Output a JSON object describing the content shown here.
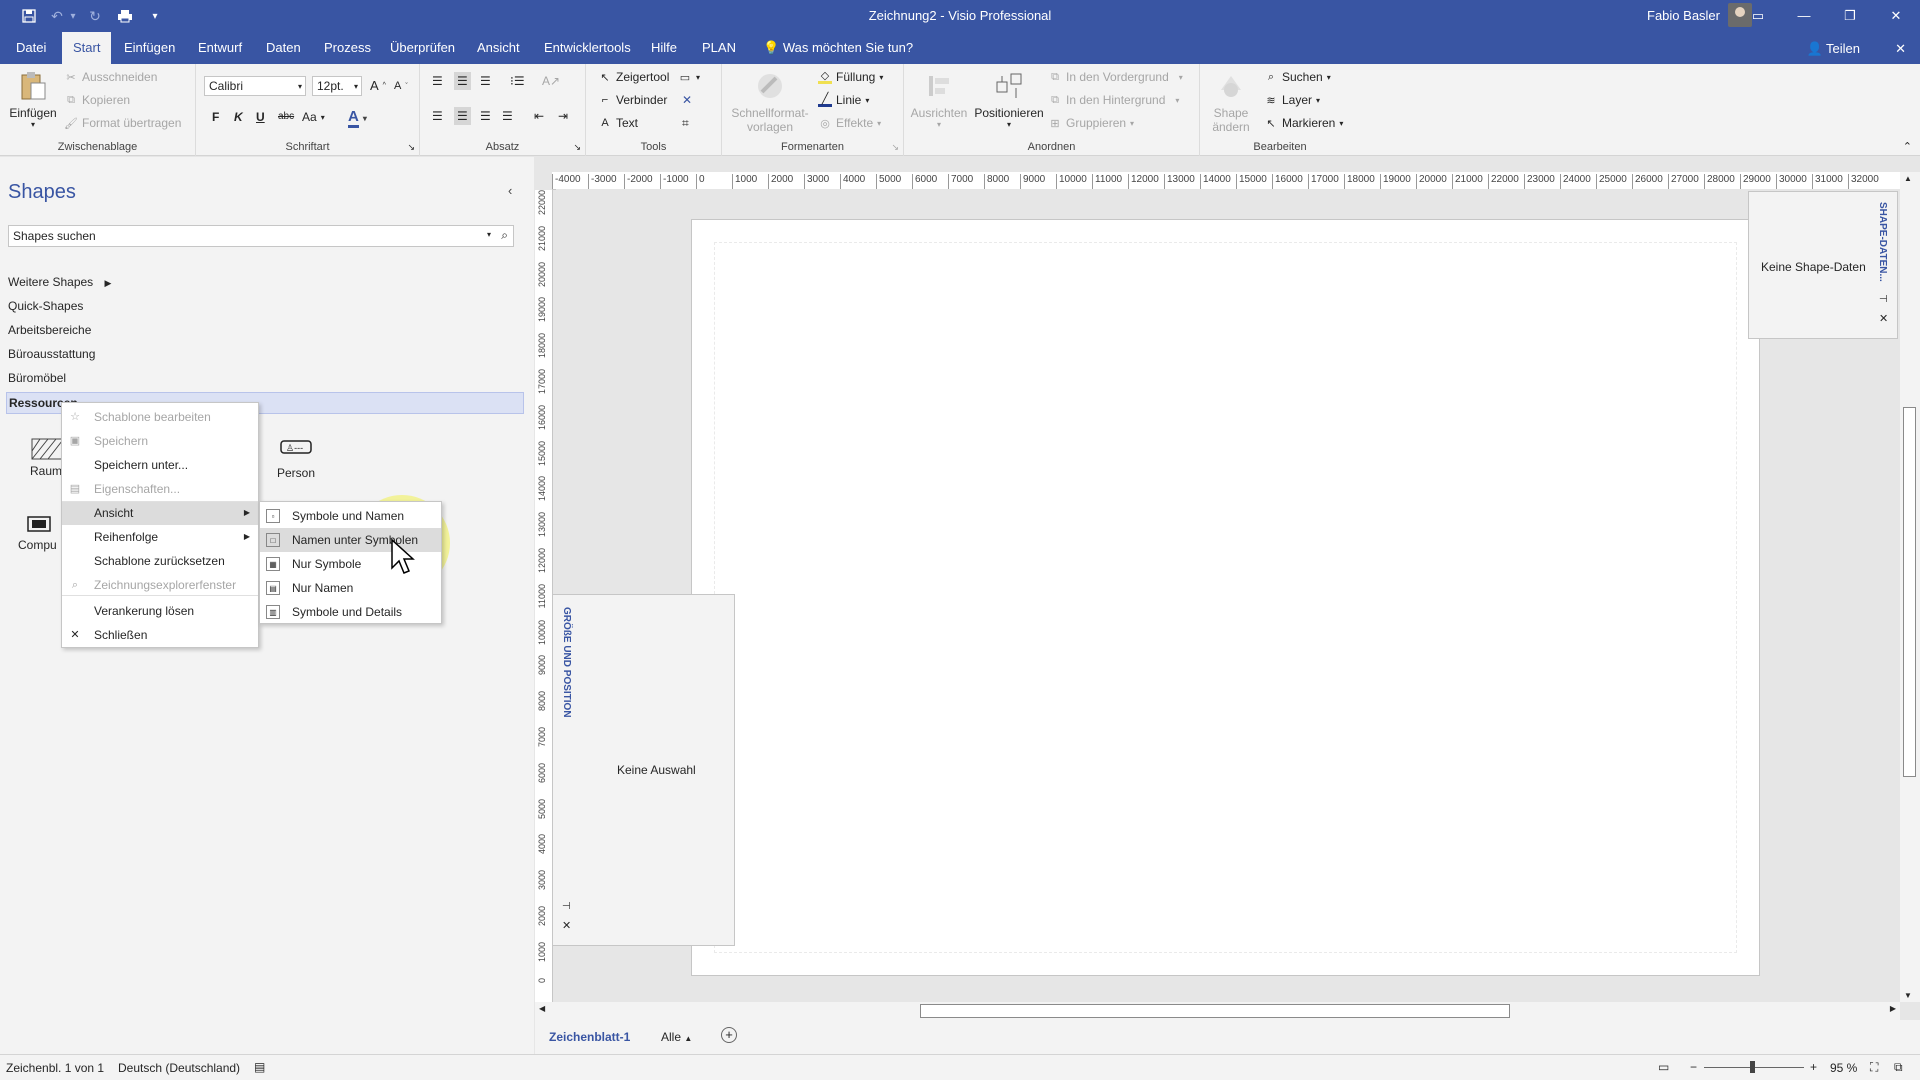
{
  "window": {
    "title": "Zeichnung2  -  Visio Professional",
    "user": "Fabio Basler"
  },
  "tabs": [
    "Datei",
    "Start",
    "Einfügen",
    "Entwurf",
    "Daten",
    "Prozess",
    "Überprüfen",
    "Ansicht",
    "Entwicklertools",
    "Hilfe",
    "PLAN"
  ],
  "active_tab": "Start",
  "tell_me": "Was möchten Sie tun?",
  "share": "Teilen",
  "ribbon": {
    "clipboard": {
      "label": "Zwischenablage",
      "paste": "Einfügen",
      "cut": "Ausschneiden",
      "copy": "Kopieren",
      "format_painter": "Format übertragen"
    },
    "font": {
      "label": "Schriftart",
      "family": "Calibri",
      "size": "12pt.",
      "bold": "F",
      "italic": "K",
      "underline": "U",
      "strike": "abc",
      "case": "Aa",
      "color": "A"
    },
    "paragraph": {
      "label": "Absatz"
    },
    "tools": {
      "label": "Tools",
      "pointer": "Zeigertool",
      "connector": "Verbinder",
      "text": "Text"
    },
    "shape_styles": {
      "label": "Formenarten",
      "quick_styles_1": "Schnellformat-",
      "quick_styles_2": "vorlagen",
      "fill": "Füllung",
      "line": "Linie",
      "effects": "Effekte"
    },
    "arrange": {
      "label": "Anordnen",
      "align": "Ausrichten",
      "position": "Positionieren",
      "front": "In den Vordergrund",
      "back": "In den Hintergrund",
      "group": "Gruppieren"
    },
    "editing": {
      "label": "Bearbeiten",
      "change_shape_1": "Shape",
      "change_shape_2": "ändern",
      "find": "Suchen",
      "layer": "Layer",
      "select": "Markieren"
    }
  },
  "shapes_pane": {
    "title": "Shapes",
    "search_placeholder": "Shapes suchen",
    "stencils": [
      "Weitere Shapes",
      "Quick-Shapes",
      "Arbeitsbereiche",
      "Büroausstattung",
      "Büromöbel"
    ],
    "selected_stencil": "Ressourcen",
    "shapes": [
      "Raum",
      "Person",
      "Compu"
    ]
  },
  "context_menu": {
    "items": [
      {
        "label": "Schablone bearbeiten",
        "disabled": true
      },
      {
        "label": "Speichern",
        "disabled": true
      },
      {
        "label": "Speichern unter...",
        "disabled": false
      },
      {
        "label": "Eigenschaften...",
        "disabled": true
      },
      {
        "label": "Ansicht",
        "disabled": false,
        "submenu": true
      },
      {
        "label": "Reihenfolge",
        "disabled": false,
        "submenu": true
      },
      {
        "label": "Schablone zurücksetzen",
        "disabled": false
      },
      {
        "label": "Zeichnungsexplorerfenster",
        "disabled": true
      },
      {
        "label": "Verankerung lösen",
        "disabled": false
      },
      {
        "label": "Schließen",
        "disabled": false
      }
    ],
    "submenu": [
      "Symbole und Namen",
      "Namen unter Symbolen",
      "Nur Symbole",
      "Nur Namen",
      "Symbole und Details"
    ],
    "submenu_highlighted": "Namen unter Symbolen"
  },
  "rulers": {
    "horizontal": [
      "-4000",
      "-3000",
      "-2000",
      "-1000",
      "0",
      "1000",
      "2000",
      "3000",
      "4000",
      "5000",
      "6000",
      "7000",
      "8000",
      "9000",
      "10000",
      "11000",
      "12000",
      "13000",
      "14000",
      "15000",
      "16000",
      "17000",
      "18000",
      "19000",
      "20000",
      "21000",
      "22000",
      "23000",
      "24000",
      "25000",
      "26000",
      "27000",
      "28000",
      "29000",
      "30000",
      "31000",
      "32000"
    ],
    "vertical": [
      "22000",
      "21000",
      "20000",
      "19000",
      "18000",
      "17000",
      "16000",
      "15000",
      "14000",
      "13000",
      "12000",
      "11000",
      "10000",
      "9000",
      "8000",
      "7000",
      "6000",
      "5000",
      "4000",
      "3000",
      "2000",
      "1000",
      "0"
    ]
  },
  "size_position_panel": {
    "title": "GRÖßE UND POSITION",
    "content": "Keine Auswahl"
  },
  "shape_data_panel": {
    "title": "SHAPE-DATEN...",
    "content": "Keine Shape-Daten"
  },
  "sheets": {
    "active": "Zeichenblatt-1",
    "all": "Alle"
  },
  "status": {
    "page": "Zeichenbl. 1 von 1",
    "language": "Deutsch (Deutschland)",
    "zoom": "95 %"
  },
  "colors": {
    "accent": "#3955a3",
    "ribbon": "#f3f3f3",
    "highlight": "#f0f050"
  }
}
